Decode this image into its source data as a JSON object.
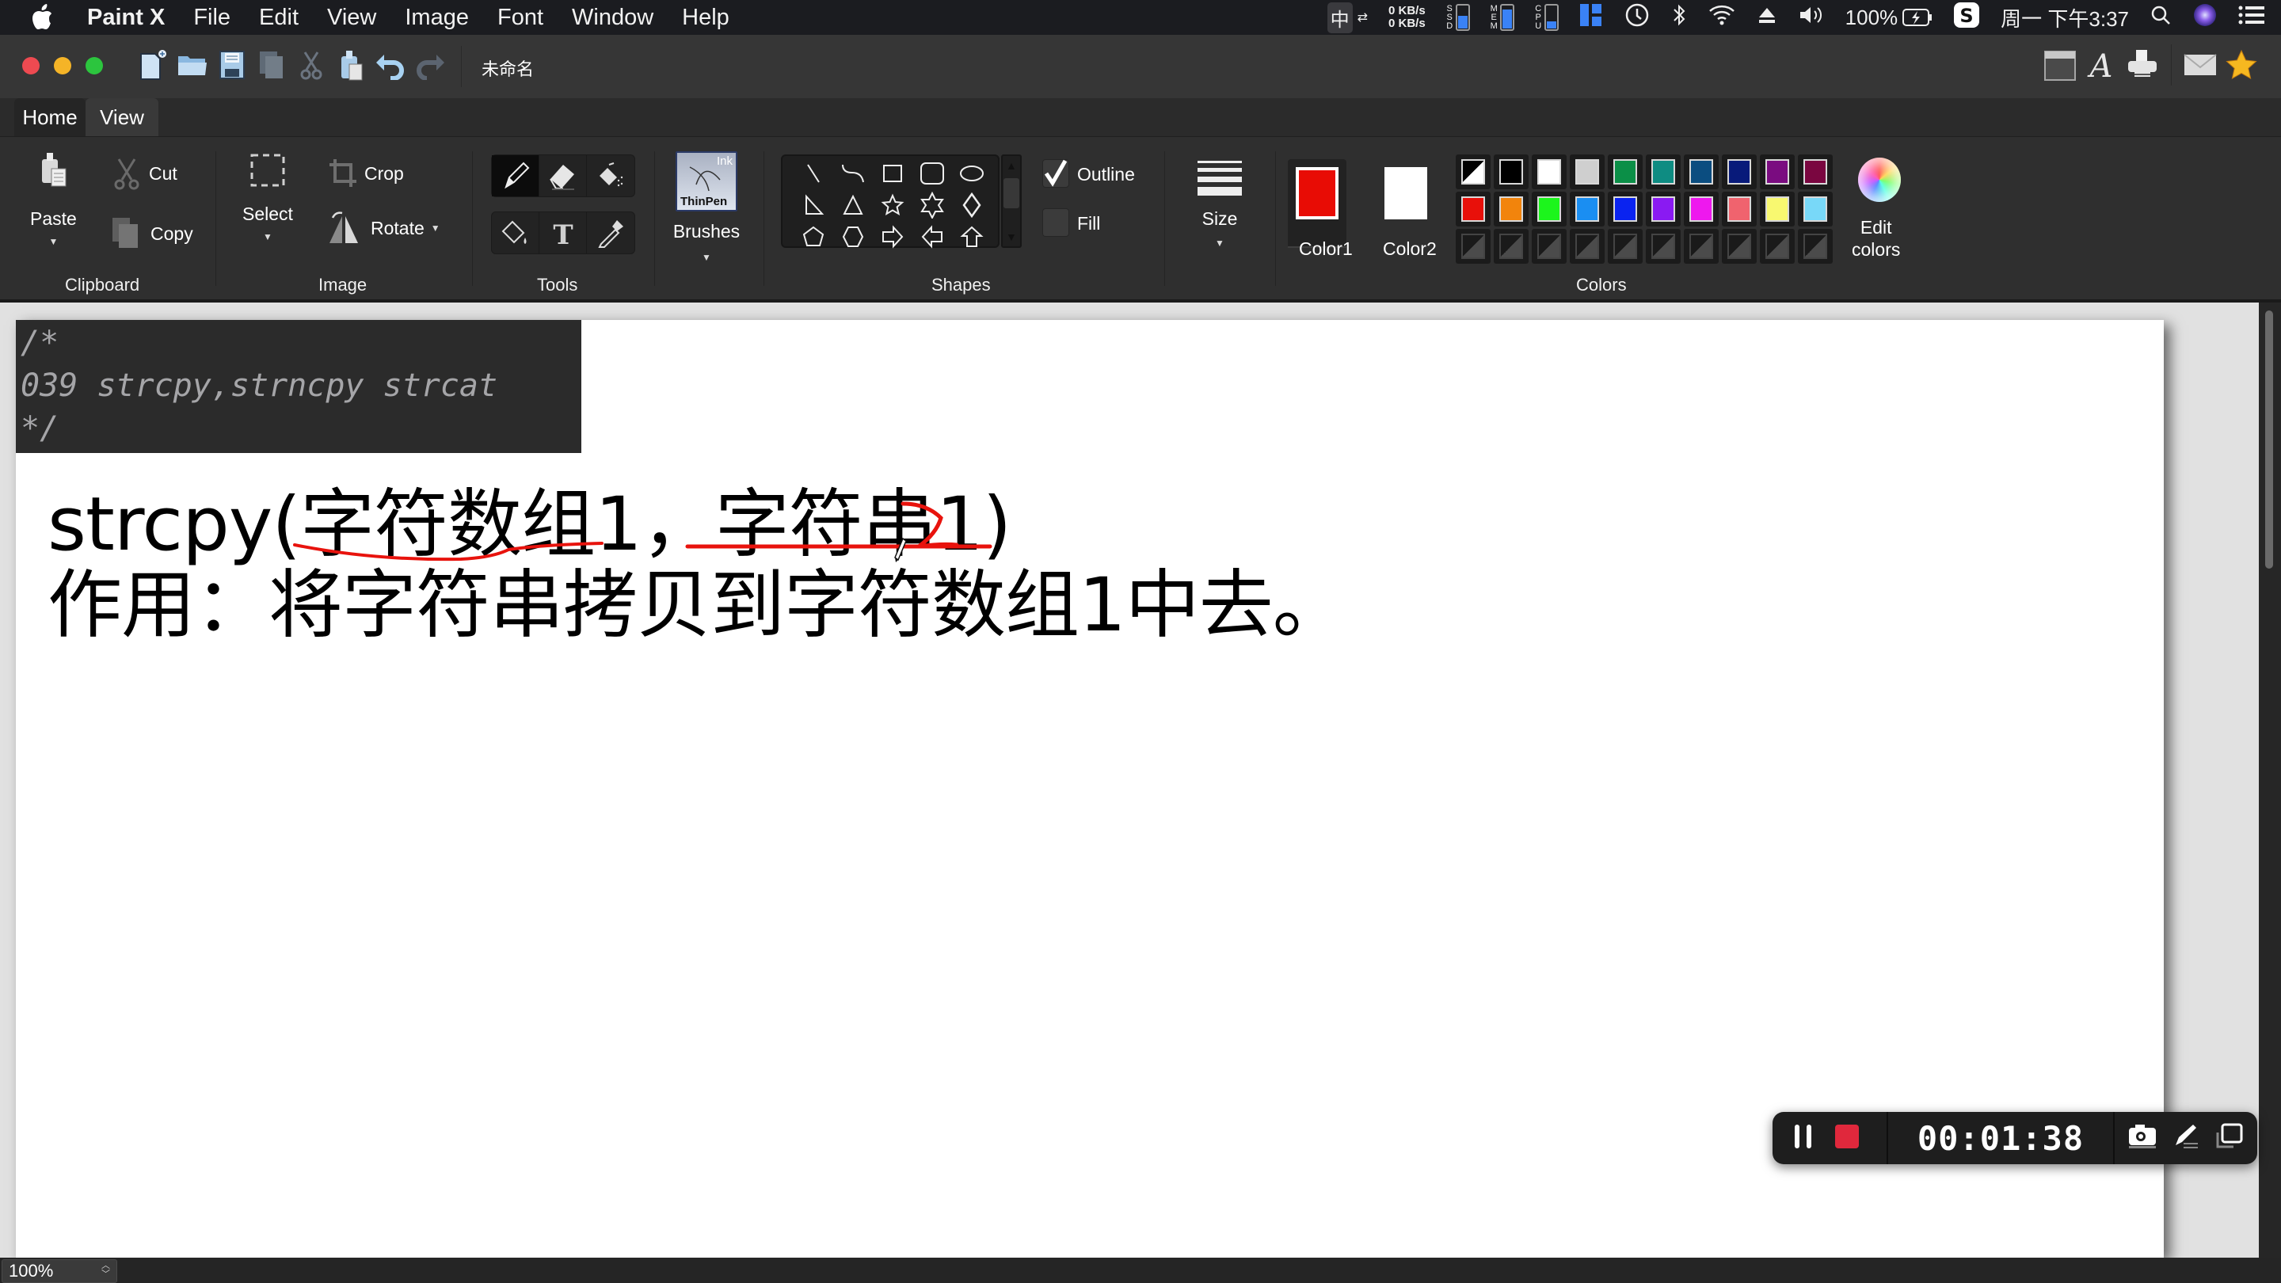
{
  "menubar": {
    "app_name": "Paint X",
    "items": [
      "File",
      "Edit",
      "View",
      "Image",
      "Font",
      "Window",
      "Help"
    ],
    "status": {
      "ime": "中",
      "net_up": "0 KB/s",
      "net_down": "0 KB/s",
      "ssd_label": "SSD",
      "mem_label": "MEM",
      "cpu_label": "CPU",
      "ssd_fill": 0.55,
      "mem_fill": 0.8,
      "cpu_fill": 0.3,
      "battery": "100%",
      "clock": "周一 下午3:37"
    }
  },
  "window": {
    "document_title": "未命名"
  },
  "tabs": [
    {
      "label": "Home",
      "active": true
    },
    {
      "label": "View",
      "active": false
    }
  ],
  "ribbon": {
    "clipboard": {
      "group": "Clipboard",
      "paste": "Paste",
      "cut": "Cut",
      "copy": "Copy"
    },
    "image": {
      "group": "Image",
      "select": "Select",
      "crop": "Crop",
      "rotate": "Rotate"
    },
    "tools": {
      "group": "Tools"
    },
    "brushes": {
      "label": "Brushes",
      "preview_top": "Ink",
      "preview_bottom": "ThinPen"
    },
    "shapes": {
      "group": "Shapes",
      "outline": "Outline",
      "outline_checked": true,
      "fill": "Fill",
      "fill_checked": false
    },
    "size": {
      "label": "Size"
    },
    "colors": {
      "group": "Colors",
      "color1_label": "Color1",
      "color2_label": "Color2",
      "color1": "#e80c05",
      "color2": "#ffffff",
      "edit_label_1": "Edit",
      "edit_label_2": "colors",
      "row1": [
        "split",
        "#000000",
        "#ffffff",
        "#cfcfcf",
        "#0b8f47",
        "#0e8c82",
        "#0b4d80",
        "#081a7a",
        "#7a0c80",
        "#7a0640"
      ],
      "row2": [
        "#e8100a",
        "#f2840c",
        "#1cf51c",
        "#1a8ef2",
        "#0a23f0",
        "#8a1af2",
        "#ee18ee",
        "#f0636e",
        "#f8f870",
        "#78d8f8"
      ]
    }
  },
  "canvas": {
    "comment_lines": [
      "/*",
      "039 strcpy,strncpy strcat",
      "*/"
    ],
    "line1": "strcpy(字符数组1，字符串1)",
    "line2": "作用：将字符串拷贝到字符数组1中去。",
    "annotation_color": "#e8130d"
  },
  "statusbar": {
    "zoom": "100%"
  },
  "recorder": {
    "time": "00:01:38",
    "stop_color": "#e0283c"
  }
}
